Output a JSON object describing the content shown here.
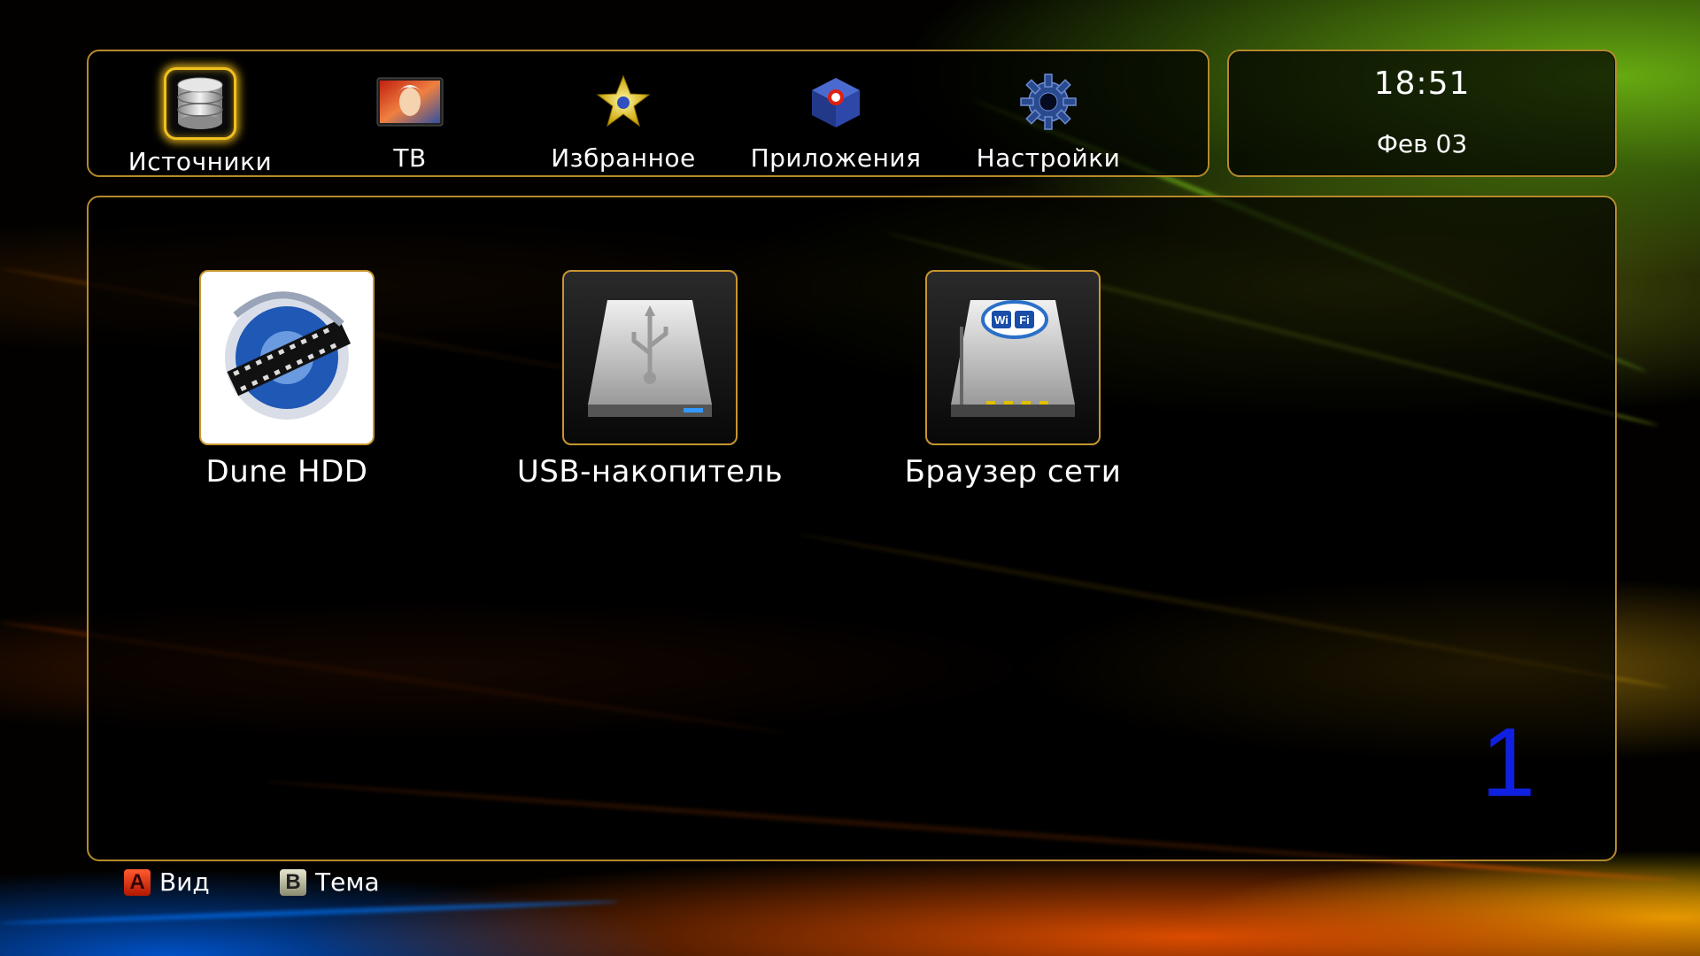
{
  "nav": {
    "items": [
      {
        "label": "Источники",
        "icon": "database-icon",
        "active": true
      },
      {
        "label": "ТВ",
        "icon": "tv-icon",
        "active": false
      },
      {
        "label": "Избранное",
        "icon": "star-icon",
        "active": false
      },
      {
        "label": "Приложения",
        "icon": "apps-cube-icon",
        "active": false
      },
      {
        "label": "Настройки",
        "icon": "gear-icon",
        "active": false
      }
    ]
  },
  "clock": {
    "time": "18:51",
    "date": "Фев 03"
  },
  "sources": [
    {
      "label": "Dune HDD",
      "icon": "film-reel-icon"
    },
    {
      "label": "USB-накопитель",
      "icon": "usb-drive-icon"
    },
    {
      "label": "Браузер сети",
      "icon": "wifi-router-icon"
    }
  ],
  "page_number": "1",
  "hints": {
    "a": {
      "key": "A",
      "label": "Вид"
    },
    "b": {
      "key": "B",
      "label": "Тема"
    }
  },
  "colors": {
    "frame": "#b58a2a",
    "active_glow": "#f0c020",
    "page_number": "#1020e0"
  }
}
